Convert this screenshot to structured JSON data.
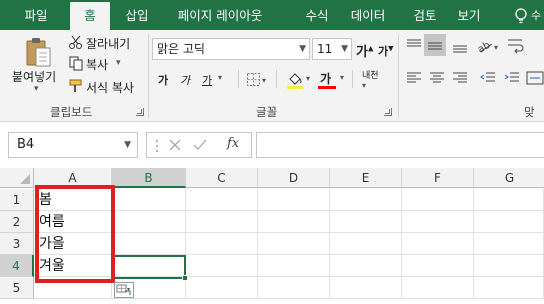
{
  "tabs": [
    "파일",
    "홈",
    "삽입",
    "페이지 레이아웃",
    "수식",
    "데이터",
    "검토",
    "보기"
  ],
  "active_tab": "홈",
  "colors": {
    "accent": "#217346",
    "highlight_box": "#e02020",
    "fill_color": "#ffeb3b",
    "font_color": "#ff0000"
  },
  "clipboard": {
    "paste_label": "붙여넣기",
    "cut_label": "잘라내기",
    "copy_label": "복사",
    "format_painter_label": "서식 복사",
    "group_label": "클립보드"
  },
  "font": {
    "font_name": "맑은 고딕",
    "font_size": "11",
    "grow_label": "가",
    "shrink_label": "가",
    "bold_label": "가",
    "italic_label": "가",
    "underline_label": "가",
    "font_color_label": "가",
    "phonetic_label": "내천",
    "group_label": "글꼴"
  },
  "alignment": {
    "group_label": "맞춤"
  },
  "formula_bar": {
    "name_box": "B4",
    "fx_label": "fx",
    "value": ""
  },
  "columns": [
    "A",
    "B",
    "C",
    "D",
    "E",
    "F",
    "G"
  ],
  "rows": [
    {
      "num": "1",
      "A": "봄"
    },
    {
      "num": "2",
      "A": "여름"
    },
    {
      "num": "3",
      "A": "가을"
    },
    {
      "num": "4",
      "A": "겨울"
    },
    {
      "num": "5",
      "A": ""
    }
  ],
  "selected_cell": "B4"
}
